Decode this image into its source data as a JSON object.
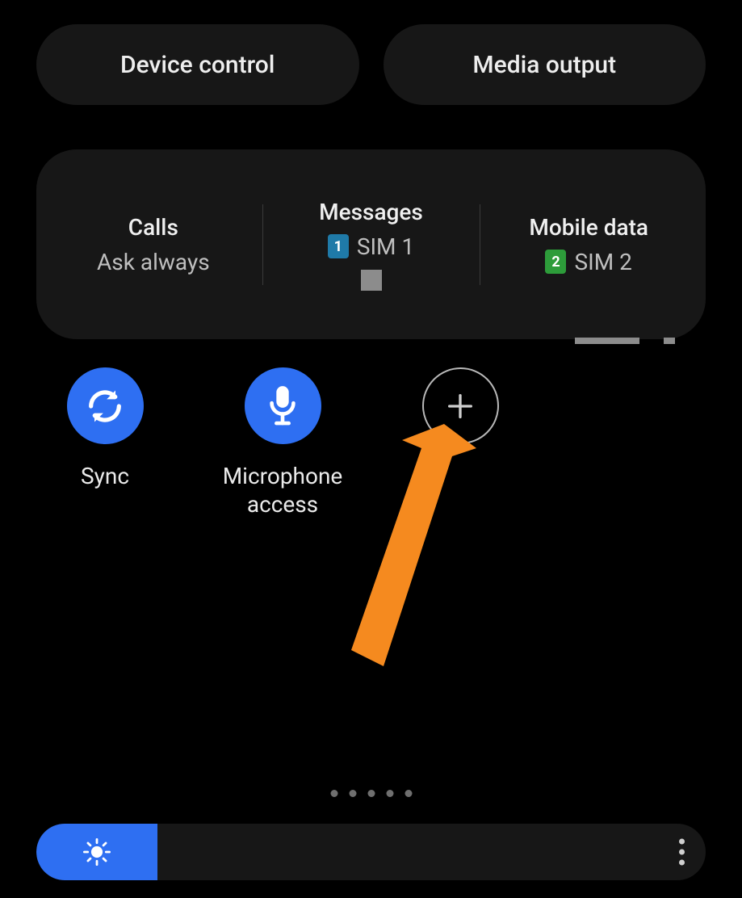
{
  "top_buttons": {
    "device_control": "Device control",
    "media_output": "Media output"
  },
  "sim_panel": {
    "calls": {
      "title": "Calls",
      "value": "Ask always"
    },
    "messages": {
      "title": "Messages",
      "value": "SIM 1",
      "badge": "1"
    },
    "mobile_data": {
      "title": "Mobile data",
      "value": "SIM 2",
      "badge": "2"
    }
  },
  "toggles": {
    "sync": {
      "label": "Sync",
      "icon": "sync-icon"
    },
    "mic": {
      "label": "Microphone\naccess",
      "icon": "microphone-icon"
    },
    "add": {
      "label": "",
      "icon": "plus-icon"
    }
  },
  "pagination": {
    "count": 5
  },
  "brightness": {
    "level_percent": 18
  },
  "colors": {
    "accent": "#2e6ff2",
    "panel": "#171717",
    "sim1": "#1f7aa8",
    "sim2": "#2d9c3a",
    "annotation": "#f58a1f"
  }
}
